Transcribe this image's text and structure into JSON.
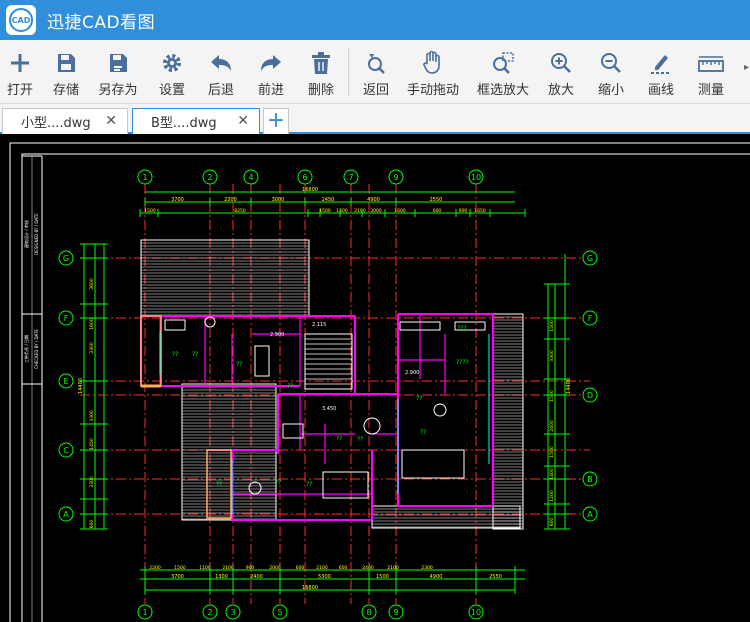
{
  "app": {
    "title": "迅捷CAD看图",
    "logo_text": "CAD"
  },
  "toolbar": {
    "items": [
      {
        "id": "open",
        "label": "打开",
        "icon": "plus-icon"
      },
      {
        "id": "save",
        "label": "存储",
        "icon": "save-icon"
      },
      {
        "id": "save_as",
        "label": "另存为",
        "icon": "save-as-icon"
      },
      {
        "id": "settings",
        "label": "设置",
        "icon": "gear-icon"
      },
      {
        "id": "back",
        "label": "后退",
        "icon": "undo-icon"
      },
      {
        "id": "forward",
        "label": "前进",
        "icon": "redo-icon"
      },
      {
        "id": "delete",
        "label": "删除",
        "icon": "trash-icon"
      },
      {
        "id": "return",
        "label": "返回",
        "icon": "return-icon"
      },
      {
        "id": "pan",
        "label": "手动拖动",
        "icon": "hand-icon"
      },
      {
        "id": "window_zoom",
        "label": "框选放大",
        "icon": "window-zoom-icon"
      },
      {
        "id": "zoom_in",
        "label": "放大",
        "icon": "zoom-in-icon"
      },
      {
        "id": "zoom_out",
        "label": "缩小",
        "icon": "zoom-out-icon"
      },
      {
        "id": "draw_line",
        "label": "画线",
        "icon": "pencil-line-icon"
      },
      {
        "id": "measure",
        "label": "测量",
        "icon": "ruler-icon"
      }
    ]
  },
  "tabs": [
    {
      "name": "小型....dwg",
      "active": false
    },
    {
      "name": "B型....dwg",
      "active": true
    }
  ],
  "drawing": {
    "axes_top": [
      "1",
      "2",
      "4",
      "6",
      "7",
      "9",
      "10"
    ],
    "axes_bottom": [
      "1",
      "2",
      "3",
      "5",
      "8",
      "9",
      "10"
    ],
    "axes_left": [
      "G",
      "F",
      "E",
      "C",
      "A"
    ],
    "axes_right": [
      "G",
      "F",
      "D",
      "B",
      "A"
    ],
    "dims_top_total": "16800",
    "dims_top_row1": [
      "3700",
      "2300",
      "3000",
      "2450",
      "4900",
      "2550"
    ],
    "dims_top_row2": [
      "1500",
      "8250",
      "1500",
      "1500",
      "2100",
      "3000",
      "1600",
      "600",
      "900",
      "1650"
    ],
    "dims_bottom_row1": [
      "2200",
      "1500",
      "1100",
      "2100",
      "900",
      "2000",
      "600",
      "2100",
      "600",
      "2400",
      "2100",
      "2300"
    ],
    "dims_bottom_row2": [
      "3700",
      "1300",
      "2400",
      "5300",
      "1500",
      "4900",
      "2550"
    ],
    "dims_bottom_total": "16800",
    "dims_left": [
      "3600",
      "1600",
      "3300",
      "3300",
      "1450",
      "3300",
      "600"
    ],
    "dims_right": [
      "1500",
      "3300",
      "1500",
      "2400",
      "1500",
      "1400",
      "1200",
      "600"
    ],
    "total_side": "14400",
    "room_labels": [
      "??",
      "??",
      "??",
      "??",
      "??",
      "??",
      "??",
      "??",
      "???",
      "????",
      "??",
      "??",
      "??"
    ],
    "level_marks": [
      "2.900",
      "3.450",
      "2.900",
      "2.115"
    ],
    "title_block_text": [
      "建筑设计 / 审核",
      "DESIGNED BY / DATE",
      "工种负责 / 日期",
      "CHECKED BY / DATE"
    ]
  }
}
